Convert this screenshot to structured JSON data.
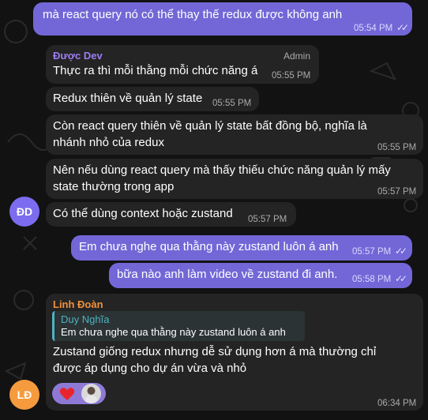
{
  "messages": {
    "m1": {
      "text": "mà react query nó có thể thay thế redux được không anh",
      "time": "05:54 PM"
    },
    "m2": {
      "sender": "Được Dev",
      "role": "Admin",
      "text": "Thực ra thì mỗi thằng mỗi chức năng á",
      "time": "05:55 PM"
    },
    "m3": {
      "text": "Redux thiên về quản lý state",
      "time": "05:55 PM"
    },
    "m4": {
      "line1": "Còn react query thiên về quản lý state bất đồng bộ, nghĩa là",
      "line2": "nhánh nhỏ của redux",
      "time": "05:55 PM"
    },
    "m5": {
      "line1": "Nên nếu dùng react query mà thấy thiếu chức năng quản lý mấy",
      "line2": "state thường trong app",
      "time": "05:57 PM"
    },
    "m6": {
      "text": "Có thể dùng context hoặc zustand",
      "time": "05:57 PM"
    },
    "m7": {
      "text": "Em chưa nghe qua thằng này zustand luôn á anh",
      "time": "05:57 PM"
    },
    "m8": {
      "text": "bữa nào anh làm video về zustand đi anh.",
      "time": "05:58 PM"
    },
    "m9": {
      "sender": "Linh Đoàn",
      "reply_sender": "Duy Nghĩa",
      "reply_text": "Em chưa nghe qua thằng này zustand luôn á anh",
      "line1": "Zustand giống redux nhưng dễ sử dụng hơn á mà thường chỉ",
      "line2": "được áp dụng cho dự án vừa và nhỏ",
      "time": "06:34 PM",
      "reaction": "heart"
    }
  },
  "avatars": {
    "dd": {
      "initials": "ĐD",
      "color": "#7b6cf0"
    },
    "ld": {
      "initials": "LĐ",
      "color": "#f59b3d"
    }
  },
  "colors": {
    "outgoing": "#7367d7",
    "incoming": "#242424",
    "sender_dev": "#9d7df2",
    "sender_linh": "#f0913d",
    "reply_accent": "#4fb3bf"
  }
}
